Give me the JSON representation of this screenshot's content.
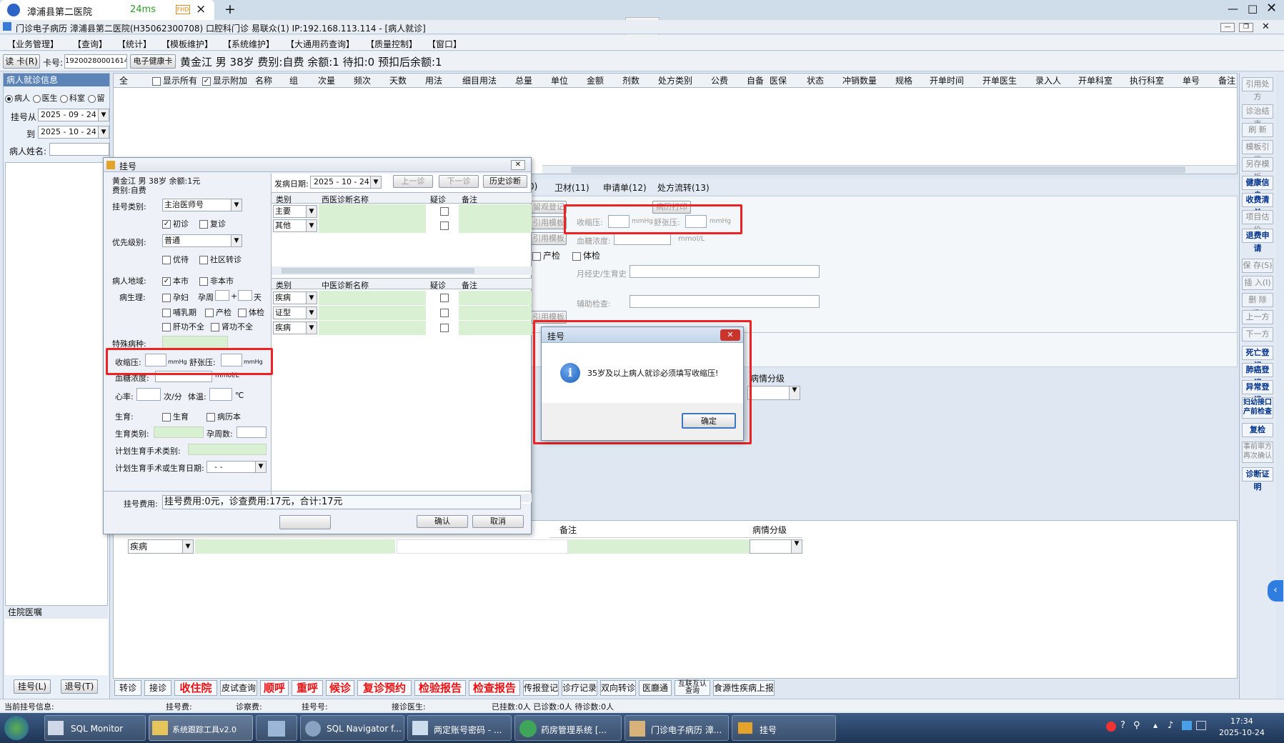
{
  "browser": {
    "tab_title": "漳浦县第二医院",
    "ping": "24ms",
    "new_tab": "+"
  },
  "app": {
    "title": "门诊电子病历  漳浦县第二医院(H35062300708)  口腔科门诊  易联众(1) IP:192.168.113.114 - [病人就诊]"
  },
  "menu": [
    "【业务管理】",
    "【查询】",
    "【统计】",
    "【模板维护】",
    "【系统维护】",
    "【大通用药查询】",
    "【质量控制】",
    "【窗口】"
  ],
  "patient_bar": {
    "read_card": "读 卡(R)",
    "card_label": "卡号:",
    "card_no": "192002800016148'",
    "ehealth": "电子健康卡",
    "info": "黄金江  男  38岁  费别:自费  余额:1  待扣:0  预扣后余额:1"
  },
  "left_panel": {
    "title": "病人就诊信息",
    "radios": [
      "病人",
      "医生",
      "科室",
      "留"
    ],
    "reg_from_label": "挂号从",
    "reg_from": "2025 - 09 - 24",
    "to_label": "到",
    "reg_to": "2025 - 10 - 24",
    "name_label": "病人姓名:",
    "hosp_orders": "住院医嘱",
    "reg_btn": "挂号(L)",
    "refund_btn": "退号(T)"
  },
  "grid": {
    "columns": [
      "全",
      "显示所有",
      "显示附加",
      "名称",
      "组",
      "次量",
      "频次",
      "天数",
      "用法",
      "细目用法",
      "总量",
      "单位",
      "金额",
      "剂数",
      "处方类别",
      "公费",
      "自备",
      "医保",
      "状态",
      "冲销数量",
      "规格",
      "开单时间",
      "开单医生",
      "录入人",
      "开单科室",
      "执行科室",
      "单号",
      "备注"
    ]
  },
  "mid_tabs": [
    "0)",
    "卫材(11)",
    "申请单(12)",
    "处方流转(13)"
  ],
  "mid_form": {
    "reg_btn": "留观登记",
    "tmpl1": "引用模板",
    "tmpl2": "引用模板",
    "tmpl3": "引用模板",
    "print": "病历打印",
    "sys_label": "收缩压:",
    "mmhg": "mmHg",
    "dia_label": "舒张压:",
    "sugar_label": "血糖浓度:",
    "mmol": "mmol/L",
    "prenatal": "产检",
    "physical": "体检",
    "history_label": "月经史/生育史",
    "aux_label": "辅助检查:",
    "grade1": "病情分级",
    "note": "备注",
    "grade2": "病情分级",
    "disease": "疾病"
  },
  "right_buttons": [
    "引用处方",
    "诊治结束",
    "刷 新",
    "模板引用",
    "另存模板",
    "健康信息",
    "收费清单",
    "项目估价",
    "退费申请",
    "保 存(S)",
    "插 入(I)",
    "删 除(D)",
    "上一方",
    "下一方",
    "死亡登记",
    "肺癌登记",
    "异常登记",
    "妇幼接口 产前检查",
    "复检",
    "事前审方 再次确认",
    "诊断证明"
  ],
  "bottom_toolbar": [
    "转诊",
    "接诊",
    "收住院",
    "皮试查询",
    "顺呼",
    "重呼",
    "候诊",
    "复诊预约",
    "检验报告",
    "检查报告",
    "传报登记",
    "诊疗记录",
    "双向转诊",
    "医廳通",
    "互联互认 查询",
    "食源性疾病上报"
  ],
  "status_bar": {
    "current": "当前挂号信息:",
    "fee": "挂号费:",
    "exam": "诊察费:",
    "regno": "挂号号:",
    "doc": "接诊医生:",
    "counts": "已挂数:0人  已诊数:0人  待诊数:0人"
  },
  "reg_dialog": {
    "title": "挂号",
    "patient": "黄金江  男  38岁  余额:1元",
    "fee_type": "费别:自费",
    "type_label": "挂号类别:",
    "type_value": "主治医师号",
    "first": "初诊",
    "revisit": "复诊",
    "priority_label": "优先级别:",
    "priority_value": "普通",
    "priority": "优待",
    "community": "社区转诊",
    "region_label": "病人地域:",
    "local": "本市",
    "nonlocal": "非本市",
    "phys_label": "病生理:",
    "pregnant": "孕妇",
    "preg_week": "孕周",
    "plus": "+",
    "day": "天",
    "lactation": "哺乳期",
    "prenatal": "产检",
    "physical": "体检",
    "liver": "肝功不全",
    "kidney": "肾功不全",
    "special_label": "特殊病种:",
    "sys_label": "收缩压:",
    "mmhg": "mmHg",
    "dia_label": "舒张压:",
    "sugar_label": "血糖浓度:",
    "mmol": "mmol/L",
    "hr_label": "心率:",
    "hr_unit": "次/分",
    "temp_label": "体温:",
    "temp_unit": "℃",
    "fert_label": "生育:",
    "fert": "生育",
    "record": "病历本",
    "fert_type": "生育类别:",
    "weeks": "孕周数:",
    "plan_type": "计划生育手术类别:",
    "plan_date": "计划生育手术或生育日期:",
    "plan_date_val": "-  -",
    "onset_label": "发病日期:",
    "onset": "2025 - 10 - 24",
    "prev": "上一诊",
    "next": "下一诊",
    "history": "历史诊断",
    "wcols": [
      "类别",
      "西医诊断名称",
      "疑诊",
      "备注"
    ],
    "wrows": [
      "主要",
      "其他"
    ],
    "ccols": [
      "类别",
      "中医诊断名称",
      "疑诊",
      "备注"
    ],
    "crows": [
      "疾病",
      "证型",
      "疾病"
    ],
    "fee_label": "挂号费用:",
    "fee_value": "挂号费用:0元，诊查费用:17元，合计:17元",
    "ok": "确认",
    "cancel": "取消"
  },
  "alert": {
    "title": "挂号",
    "message": "35岁及以上病人就诊必须填写收缩压!",
    "ok": "确定"
  },
  "taskbar": {
    "items": [
      "SQL Monitor",
      "系统跟踪工具v2.0",
      "",
      "SQL Navigator f...",
      "两定账号密码 - ...",
      "药房管理系统 [...",
      "门诊电子病历 漳...",
      "挂号"
    ],
    "time": "17:34",
    "date": "2025-10-24"
  }
}
